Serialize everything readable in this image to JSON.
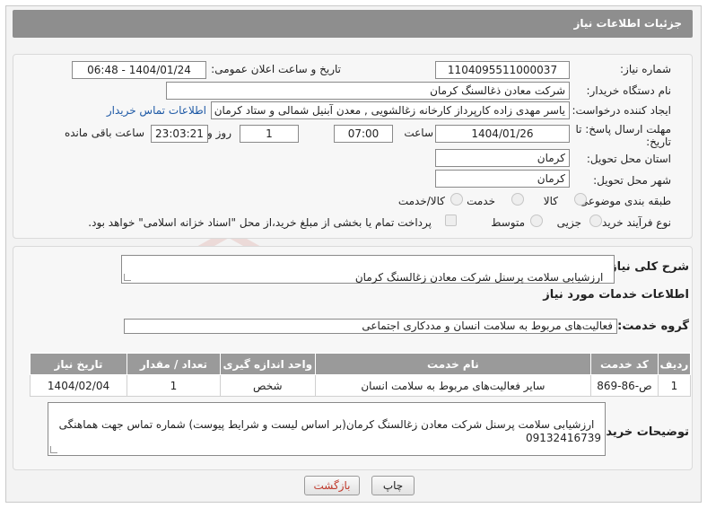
{
  "header": {
    "title": "جزئیات اطلاعات نیاز"
  },
  "fields": {
    "need_number_label": "شماره نیاز:",
    "need_number": "1104095511000037",
    "announce_label": "تاریخ و ساعت اعلان عمومی:",
    "announce_value": "1404/01/24 - 06:48",
    "buyer_org_label": "نام دستگاه خریدار:",
    "buyer_org": "شرکت معادن ذغالسنگ کرمان",
    "creator_label": "ایجاد کننده درخواست:",
    "creator": "یاسر مهدی زاده کارپرداز کارخانه زغالشویی , معدن آبنیل شمالی و ستاد کرمان ,",
    "contact_link": "اطلاعات تماس خریدار",
    "deadline_label_1": "مهلت ارسال پاسخ: تا",
    "deadline_label_2": "تاریخ:",
    "deadline_date": "1404/01/26",
    "time_label": "ساعت",
    "deadline_time": "07:00",
    "days_value": "1",
    "days_label": "روز و",
    "remaining_time": "23:03:21",
    "remaining_label": "ساعت باقی مانده",
    "province_label": "استان محل تحویل:",
    "province": "کرمان",
    "city_label": "شهر محل تحویل:",
    "city": "کرمان",
    "category_label": "طبقه بندی موضوعی:",
    "category_options": [
      "کالا",
      "خدمت",
      "کالا/خدمت"
    ],
    "process_label": "نوع فرآیند خرید :",
    "process_options": [
      "جزیی",
      "متوسط"
    ],
    "payment_note": "پرداخت تمام یا بخشی از مبلغ خرید،از محل \"اسناد خزانه اسلامی\" خواهد بود."
  },
  "need": {
    "summary_label": "شرح کلی نیاز:",
    "summary": "ارزشیابی سلامت پرسنل شرکت معادن زغالسنگ کرمان",
    "services_title": "اطلاعات خدمات مورد نیاز",
    "group_label": "گروه خدمت:",
    "group": "فعالیت‌های مربوط به سلامت انسان و مددکاری اجتماعی"
  },
  "table": {
    "headers": [
      "ردیف",
      "کد خدمت",
      "نام خدمت",
      "واحد اندازه گیری",
      "تعداد / مقدار",
      "تاریخ نیاز"
    ],
    "rows": [
      [
        "1",
        "ص-86-869",
        "سایر فعالیت‌های مربوط به سلامت انسان",
        "شخص",
        "1",
        "1404/02/04"
      ]
    ]
  },
  "buyer_notes": {
    "label": "توضیحات خریدار:",
    "text": "ارزشیابی سلامت پرسنل شرکت معادن زغالسنگ کرمان(بر اساس لیست و شرایط پیوست) شماره تماس جهت هماهنگی 09132416739"
  },
  "buttons": {
    "print": "چاپ",
    "back": "بازگشت"
  },
  "watermark": {
    "text": "AriaTender.neT"
  },
  "colors": {
    "header": "#8e8e8e",
    "link": "#1f5aa6",
    "watermark": "#c0392b",
    "back_text": "#c0392b"
  }
}
